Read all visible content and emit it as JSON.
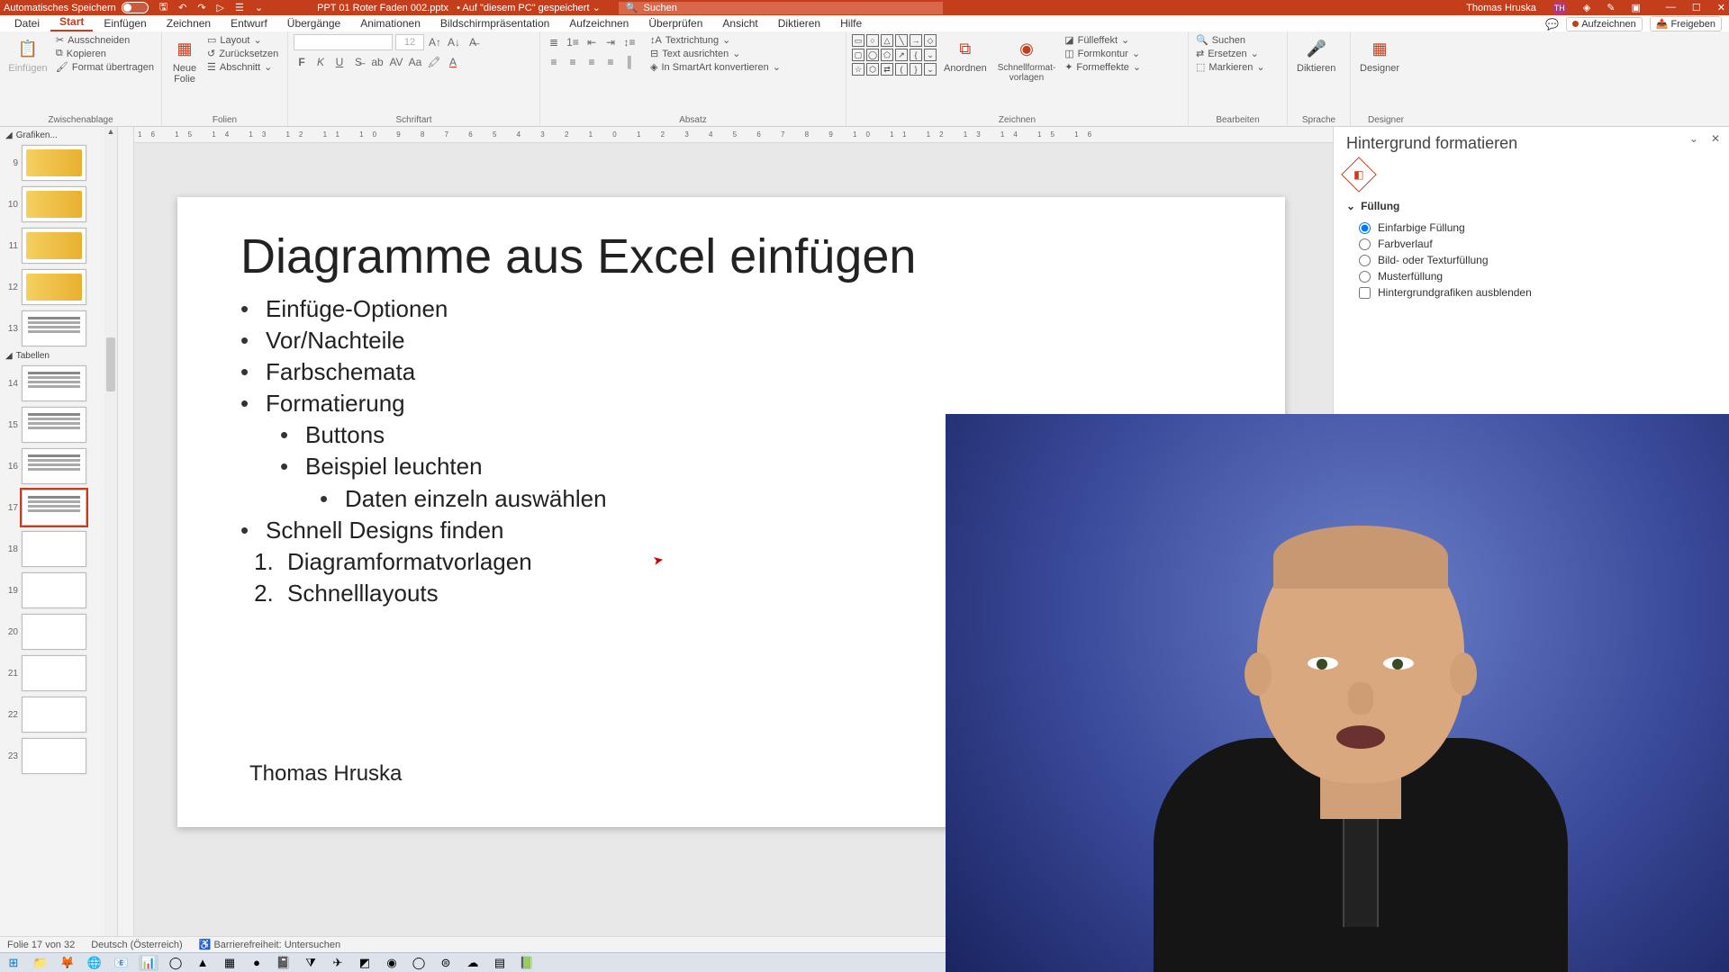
{
  "titlebar": {
    "autosave": "Automatisches Speichern",
    "filename": "PPT 01 Roter Faden 002.pptx",
    "saved_hint": "• Auf \"diesem PC\" gespeichert ⌄",
    "search_placeholder": "Suchen",
    "username": "Thomas Hruska",
    "initials": "TH"
  },
  "tabs": {
    "items": [
      "Datei",
      "Start",
      "Einfügen",
      "Zeichnen",
      "Entwurf",
      "Übergänge",
      "Animationen",
      "Bildschirmpräsentation",
      "Aufzeichnen",
      "Überprüfen",
      "Ansicht",
      "Diktieren",
      "Hilfe"
    ],
    "record": "Aufzeichnen",
    "share": "Freigeben"
  },
  "ribbon": {
    "clipboard": {
      "label": "Zwischenablage",
      "paste": "Einfügen",
      "cut": "Ausschneiden",
      "copy": "Kopieren",
      "format": "Format übertragen"
    },
    "slides": {
      "label": "Folien",
      "new": "Neue\nFolie",
      "layout": "Layout",
      "reset": "Zurücksetzen",
      "section": "Abschnitt"
    },
    "font": {
      "label": "Schriftart",
      "size": "12"
    },
    "para": {
      "label": "Absatz",
      "textdir": "Textrichtung",
      "align": "Text ausrichten",
      "smartart": "In SmartArt konvertieren"
    },
    "draw": {
      "label": "Zeichnen",
      "arrange": "Anordnen",
      "quickstyles": "Schnellformat-\nvorlagen",
      "fill": "Fülleffekt",
      "outline": "Formkontur",
      "effects": "Formeffekte"
    },
    "edit": {
      "label": "Bearbeiten",
      "find": "Suchen",
      "replace": "Ersetzen",
      "select": "Markieren"
    },
    "voice": {
      "label": "Sprache",
      "dictate": "Diktieren"
    },
    "designer": {
      "label": "Designer",
      "designer": "Designer"
    }
  },
  "thumbs": {
    "section1": "Grafiken...",
    "section2": "Tabellen",
    "nums": [
      "9",
      "10",
      "11",
      "12",
      "13",
      "14",
      "15",
      "16",
      "17",
      "18",
      "19",
      "20",
      "21",
      "22",
      "23"
    ]
  },
  "slide": {
    "title": "Diagramme aus Excel einfügen",
    "b1": "Einfüge-Optionen",
    "b2": "Vor/Nachteile",
    "b3": "Farbschemata",
    "b4": "Formatierung",
    "b4a": "Buttons",
    "b4b": "Beispiel leuchten",
    "b4b1": "Daten einzeln auswählen",
    "b5": "Schnell Designs finden",
    "b5a": "Diagramformatvorlagen",
    "b5b": "Schnelllayouts",
    "author": "Thomas Hruska"
  },
  "pane": {
    "title": "Hintergrund formatieren",
    "section": "Füllung",
    "o1": "Einfarbige Füllung",
    "o2": "Farbverlauf",
    "o3": "Bild- oder Texturfüllung",
    "o4": "Musterfüllung",
    "o5": "Hintergrundgrafiken ausblenden"
  },
  "status": {
    "slide": "Folie 17 von 32",
    "lang": "Deutsch (Österreich)",
    "access": "Barrierefreiheit: Untersuchen"
  },
  "ruler": "16 15 14 13 12 11 10 9 8 7 6 5 4 3 2 1 0 1 2 3 4 5 6 7 8 9 10 11 12 13 14 15 16"
}
